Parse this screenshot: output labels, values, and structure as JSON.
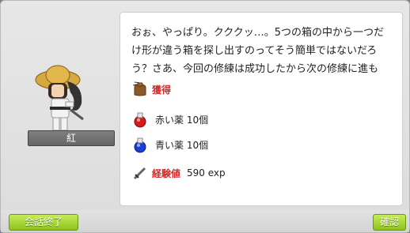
{
  "npc": {
    "name": "紅"
  },
  "dialog": {
    "text": "おぉ、やっぱり。クククッ…。5つの箱の中から一つだけ形が違う箱を探し出すのってそう簡単ではないだろう？さあ、今回の修練は成功したから次の修練に進もう。"
  },
  "rewards": {
    "obtain_label": "獲得",
    "items": [
      {
        "name": "赤い薬 10個",
        "icon": "red-potion-icon"
      },
      {
        "name": "青い薬 10個",
        "icon": "blue-potion-icon"
      }
    ],
    "exp_label": "経験値",
    "exp_value": "590 exp"
  },
  "buttons": {
    "end_chat": "会話終了",
    "ok": "確認"
  }
}
